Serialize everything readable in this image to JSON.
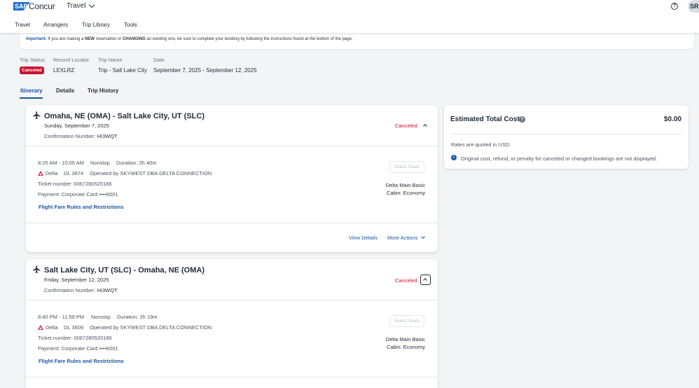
{
  "header": {
    "brand_sap": "SAP",
    "brand_concur": "Concur",
    "app_name": "Travel",
    "user_initials": "SR",
    "help_icon": "help-circle-icon",
    "nav": [
      "Travel",
      "Arrangers",
      "Trip Library",
      "Tools"
    ]
  },
  "notice": {
    "important": "Important:",
    "text1": "If you are making a",
    "new": "NEW",
    "text2": "reservation or",
    "changing": "CHANGING",
    "text3": "an existing one, be sure to complete your booking by following the instructions found at the bottom of the page."
  },
  "trip": {
    "status_label": "Trip Status",
    "status": "Canceled",
    "locator_label": "Record Locator",
    "locator": "LEXLRZ",
    "name_label": "Trip Name",
    "name": "Trip - Salt Lake City",
    "date_label": "Date",
    "date": "September 7, 2025 - September 12, 2025"
  },
  "tabs": [
    "Itinerary",
    "Details",
    "Trip History"
  ],
  "segments": [
    {
      "title": "Omaha, NE (OMA) - Salt Lake City, UT (SLC)",
      "date": "Sunday, September 7, 2025",
      "conf_label": "Confirmation Number:",
      "conf": "HI3WQT",
      "status": "Canceled",
      "time": "8:25 AM - 10:05 AM",
      "stops": "Nonstop",
      "duration": "Duration: 2h 40m",
      "airline": "Delta",
      "flight": "DL 3874",
      "operated": "Operated by SKYWEST DBA DELTA CONNECTION",
      "ticket": "Ticket number: 0067280520186",
      "payment": "Payment: Corporate Card ••••6001",
      "fare_rules": "Flight Fare Rules and Restrictions",
      "select_seats": "Select Seats",
      "fare_class": "Delta Main Basic",
      "cabin": "Cabin: Economy",
      "view_details": "View Details",
      "more_actions": "More Actions"
    },
    {
      "title": "Salt Lake City, UT (SLC) - Omaha, NE (OMA)",
      "date": "Friday, September 12, 2025",
      "conf_label": "Confirmation Number:",
      "conf": "HI3WQT",
      "status": "Canceled",
      "time": "8:40 PM - 11:59 PM",
      "stops": "Nonstop",
      "duration": "Duration: 2h 19m",
      "airline": "Delta",
      "flight": "DL 3609",
      "operated": "Operated by SKYWEST DBA DELTA CONNECTION",
      "ticket": "Ticket number: 0067280520186",
      "payment": "Payment: Corporate Card ••••6001",
      "fare_rules": "Flight Fare Rules and Restrictions",
      "select_seats": "Select Seats",
      "fare_class": "Delta Main Basic",
      "cabin": "Cabin: Economy"
    }
  ],
  "cost": {
    "title": "Estimated Total Cost",
    "amount": "$0.00",
    "currency_note": "Rates are quoted in USD.",
    "info_note": "Original cost, refund, or penalty for canceled or changed bookings are not displayed."
  },
  "colors": {
    "accent": "#1b56a6",
    "canceled": "#c8102e",
    "sap_blue": "#1b6fc9"
  }
}
